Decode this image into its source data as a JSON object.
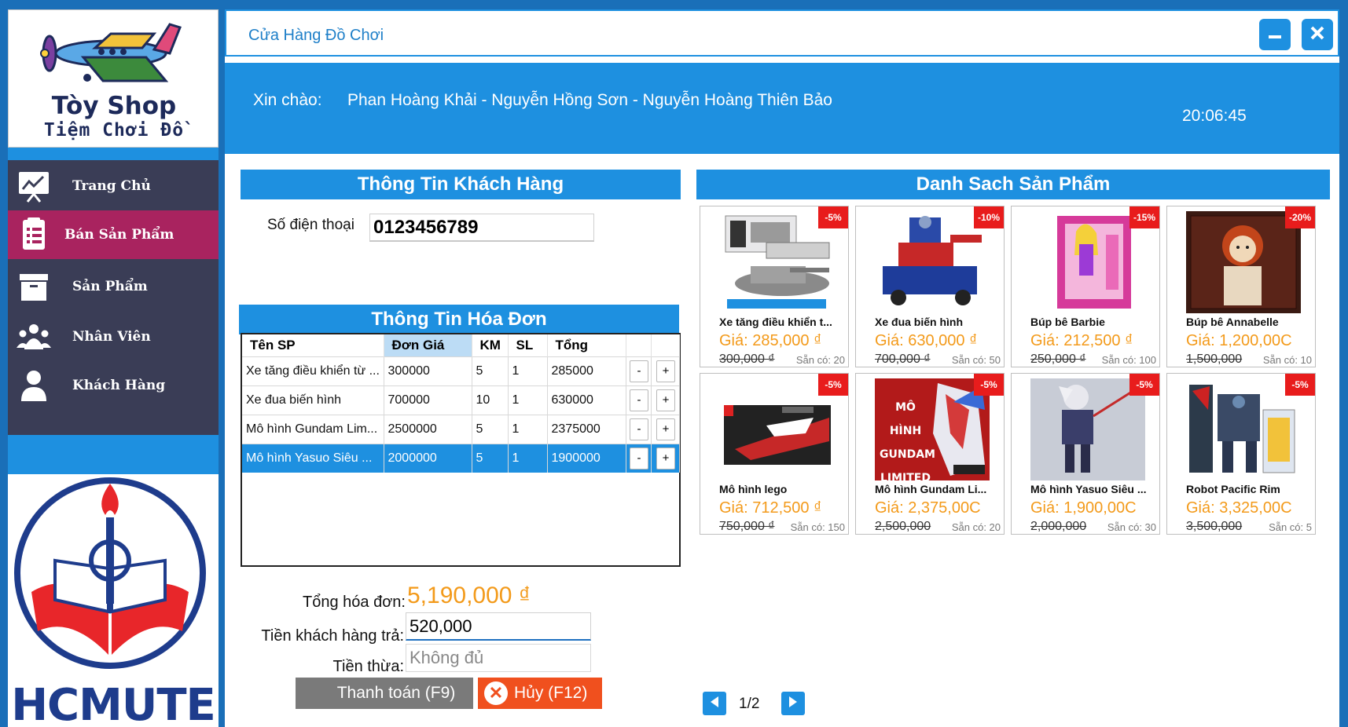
{
  "sidebar": {
    "logo_title": "Tòy Shop",
    "logo_subtitle": "Tiệm Chơi Đồ",
    "menu": [
      {
        "label": "Trang Chủ",
        "icon": "chart-board-icon"
      },
      {
        "label": "Bán Sản Phẩm",
        "icon": "invoice-icon"
      },
      {
        "label": "Sản Phẩm",
        "icon": "archive-box-icon"
      },
      {
        "label": "Nhân Viên",
        "icon": "group-icon"
      },
      {
        "label": "Khách Hàng",
        "icon": "person-icon"
      }
    ],
    "active_item": "Bán Sản Phẩm",
    "school_name": "HCMUTE"
  },
  "window": {
    "title": "Cửa Hàng Đồ Chơi",
    "minimize_icon": "minimize-icon",
    "close_icon": "close-icon"
  },
  "header": {
    "greeting_label": "Xin chào:",
    "greeting_names": "Phan Hoàng Khải - Nguyễn Hồng Sơn - Nguyễn Hoàng Thiên Bảo",
    "clock": "20:06:45"
  },
  "customer": {
    "section_title": "Thông Tin Khách Hàng",
    "phone_label": "Số điện thoại",
    "phone_value": "0123456789"
  },
  "invoice": {
    "section_title": "Thông Tin Hóa Đơn",
    "columns": [
      "Tên SP",
      "Đơn Giá",
      "KM",
      "SL",
      "Tổng"
    ],
    "rows": [
      {
        "name": "Xe tăng điều khiển từ ...",
        "price": "300000",
        "km": "5",
        "qty": "1",
        "total": "285000"
      },
      {
        "name": "Xe đua biến hình",
        "price": "700000",
        "km": "10",
        "qty": "1",
        "total": "630000"
      },
      {
        "name": "Mô hình Gundam Lim...",
        "price": "2500000",
        "km": "5",
        "qty": "1",
        "total": "2375000"
      },
      {
        "name": "Mô hình Yasuo Siêu ...",
        "price": "2000000",
        "km": "5",
        "qty": "1",
        "total": "1900000"
      }
    ],
    "selected_row": 3,
    "minus_label": "-",
    "plus_label": "+"
  },
  "summary": {
    "total_label": "Tổng hóa đơn:",
    "total_value": "5,190,000 ₫",
    "paid_label": "Tiền khách hàng trả:",
    "paid_value": "520,000",
    "change_label": "Tiền thừa:",
    "change_value": "Không đủ",
    "pay_button": "Thanh toán (F9)",
    "cancel_button": "Hủy (F12)"
  },
  "products": {
    "section_title": "Danh Sach Sản Phẩm",
    "items": [
      {
        "name": "Xe tăng điều khiển t...",
        "price": "Giá: 285,000 ₫",
        "old_price": "300,000 ₫",
        "stock": "Sẵn có: 20",
        "badge": "-5%",
        "icon": "tank-toy-icon"
      },
      {
        "name": "Xe đua biến hình",
        "price": "Giá: 630,000 ₫",
        "old_price": "700,000 ₫",
        "stock": "Sẵn có: 50",
        "badge": "-10%",
        "icon": "robot-truck-icon"
      },
      {
        "name": "Búp bê Barbie",
        "price": "Giá: 212,500 ₫",
        "old_price": "250,000 ₫",
        "stock": "Sẵn có: 100",
        "badge": "-15%",
        "icon": "doll-box-icon"
      },
      {
        "name": "Búp bê Annabelle",
        "price": "Giá: 1,200,00C",
        "old_price": "1,500,000",
        "stock": "Sẵn có: 10",
        "badge": "-20%",
        "icon": "doll-icon"
      },
      {
        "name": "Mô hình lego",
        "price": "Giá: 712,500 ₫",
        "old_price": "750,000 ₫",
        "stock": "Sẵn có: 150",
        "badge": "-5%",
        "icon": "lego-box-icon"
      },
      {
        "name": "Mô hình Gundam Li...",
        "price": "Giá: 2,375,00C",
        "old_price": "2,500,000",
        "stock": "Sẵn có: 20",
        "badge": "-5%",
        "icon": "gundam-icon"
      },
      {
        "name": "Mô hình Yasuo Siêu ...",
        "price": "Giá: 1,900,00C",
        "old_price": "2,000,000",
        "stock": "Sẵn có: 30",
        "badge": "-5%",
        "icon": "figure-icon"
      },
      {
        "name": "Robot Pacific Rim",
        "price": "Giá: 3,325,00C",
        "old_price": "3,500,000",
        "stock": "Sẵn có: 5",
        "badge": "-5%",
        "icon": "robot-icon"
      }
    ],
    "page": "1/2",
    "prev_icon": "prev-arrow-icon",
    "next_icon": "next-arrow-icon",
    "gundam_image_text": [
      "MÔ HÌNH",
      "GUNDAM",
      "LIMITED"
    ]
  },
  "colors": {
    "accent": "#1e90e0",
    "sidebar_bg": "#3a3d56",
    "active_menu": "#a9235f",
    "price_orange": "#f39a1a",
    "badge_red": "#e81c1c",
    "cancel_orange": "#f0501e"
  }
}
